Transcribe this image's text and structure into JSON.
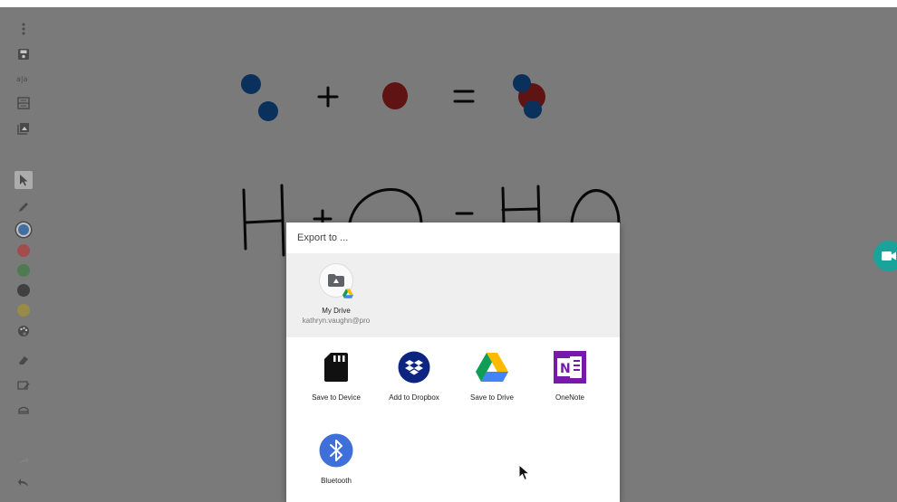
{
  "toolbar": {
    "tools": [
      "more-icon",
      "save-icon",
      "text-size-icon",
      "pages-icon",
      "gallery-icon",
      "select-icon",
      "pen-icon"
    ],
    "colors": [
      "#1565c0",
      "#c62828",
      "#2e7d32",
      "#111111",
      "#b09a1a"
    ],
    "lower_tools": [
      "palette-icon",
      "eraser-icon",
      "clear-icon",
      "fill-icon"
    ],
    "history": [
      "redo-icon",
      "undo-icon"
    ]
  },
  "export_dialog": {
    "title": "Export to ...",
    "recent": {
      "name": "My Drive",
      "account": "kathryn.vaughn@pro"
    },
    "apps": [
      {
        "label": "Save to Device"
      },
      {
        "label": "Add to Dropbox"
      },
      {
        "label": "Save to Drive"
      },
      {
        "label": "OneNote"
      },
      {
        "label": "Bluetooth"
      }
    ]
  },
  "colors": {
    "scrim": "rgba(0,0,0,0.52)",
    "fab": "#1aa39a",
    "dropbox": "#0d2481",
    "onenote": "#7719aa",
    "bluetooth": "#3f6fd8"
  }
}
